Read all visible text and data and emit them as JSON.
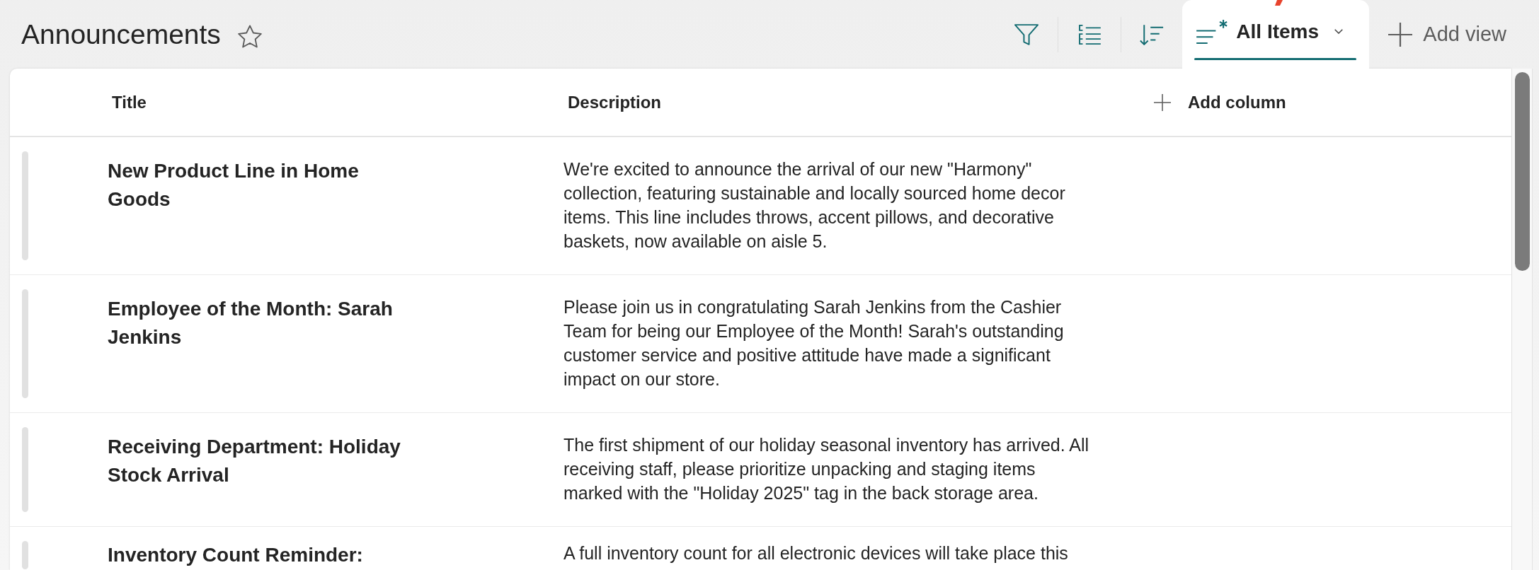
{
  "header": {
    "title": "Announcements",
    "favorite": false
  },
  "views": {
    "tabs": [
      {
        "label": "All Items",
        "selected": true
      }
    ],
    "add_view": "Add view"
  },
  "list": {
    "columns": [
      {
        "label": "Title"
      },
      {
        "label": "Description"
      }
    ],
    "add_column": "Add column",
    "rows": [
      {
        "title": "New Product Line in Home Goods",
        "description": "We're excited to announce the arrival of our new \"Harmony\" collection, featuring sustainable and locally sourced home decor items. This line includes throws, accent pillows, and decorative baskets, now available on aisle 5."
      },
      {
        "title": "Employee of the Month: Sarah Jenkins",
        "description": "Please join us in congratulating Sarah Jenkins from the Cashier Team for being our Employee of the Month! Sarah's outstanding customer service and positive attitude have made a significant impact on our store."
      },
      {
        "title": "Receiving Department: Holiday Stock Arrival",
        "description": "The first shipment of our holiday seasonal inventory has arrived. All receiving staff, please prioritize unpacking and staging items marked with the \"Holiday 2025\" tag in the back storage area."
      },
      {
        "title": "Inventory Count Reminder:",
        "description": "A full inventory count for all electronic devices will take place this"
      }
    ]
  }
}
